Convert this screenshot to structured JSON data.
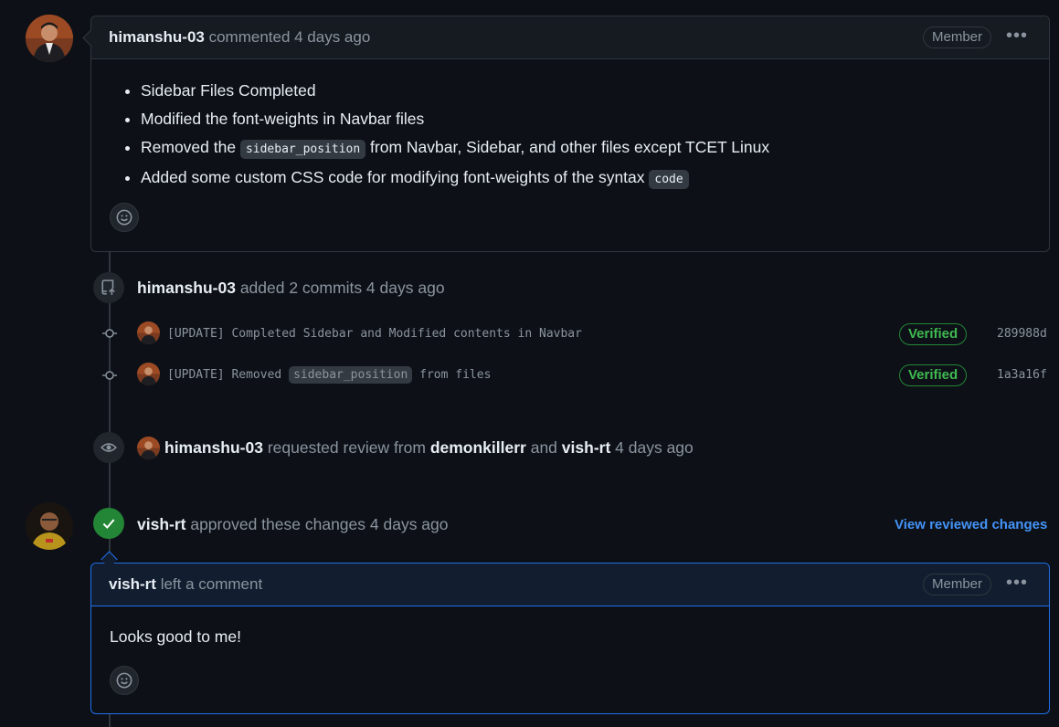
{
  "comment1": {
    "author": "himanshu-03",
    "action": " commented 4 days ago",
    "badge": "Member",
    "bullets": {
      "b1": "Sidebar Files Completed",
      "b2": "Modified the font-weights in Navbar files",
      "b3_pre": "Removed the ",
      "b3_code": "sidebar_position",
      "b3_post": " from Navbar, Sidebar, and other files except TCET Linux",
      "b4_pre": "Added some custom CSS code for modifying font-weights of the syntax ",
      "b4_code": "code"
    }
  },
  "commits_event": {
    "author": "himanshu-03",
    "text": " added 2 commits 4 days ago",
    "commits": [
      {
        "msg": "[UPDATE] Completed Sidebar and Modified contents in Navbar",
        "verified": "Verified",
        "sha": "289988d"
      },
      {
        "msg_pre": "[UPDATE] Removed ",
        "msg_code": "sidebar_position",
        "msg_post": " from files",
        "verified": "Verified",
        "sha": "1a3a16f"
      }
    ]
  },
  "review_request": {
    "author": "himanshu-03",
    "text1": " requested review from ",
    "reviewer1": "demonkillerr",
    "text2": " and ",
    "reviewer2": "vish-rt",
    "text3": " 4 days ago"
  },
  "approval": {
    "author": "vish-rt",
    "text": " approved these changes 4 days ago",
    "link": "View reviewed changes"
  },
  "comment2": {
    "author": "vish-rt",
    "action": " left a comment",
    "badge": "Member",
    "body": "Looks good to me!"
  },
  "colors": {
    "background": "#0d1117",
    "border": "#30363d",
    "accent_blue": "#4493f8",
    "success_green": "#238636"
  },
  "icons": [
    "kebab-horizontal-icon",
    "smiley-icon",
    "repo-push-icon",
    "git-commit-icon",
    "eye-icon",
    "check-icon"
  ]
}
